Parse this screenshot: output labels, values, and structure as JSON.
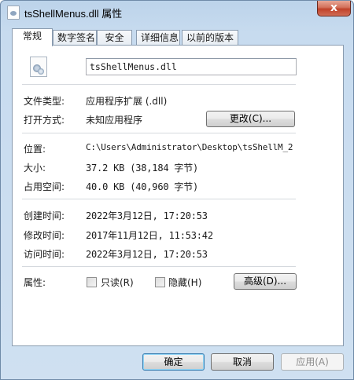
{
  "window": {
    "title": "tsShellMenus.dll 属性",
    "close_glyph": "x"
  },
  "tabs": [
    {
      "label": "常规",
      "active": true
    },
    {
      "label": "数字签名",
      "active": false
    },
    {
      "label": "安全",
      "active": false
    },
    {
      "label": "详细信息",
      "active": false
    },
    {
      "label": "以前的版本",
      "active": false
    }
  ],
  "file": {
    "name": "tsShellMenus.dll",
    "icon": "dll-file-icon"
  },
  "type_section": {
    "file_type_label": "文件类型:",
    "file_type_value": "应用程序扩展 (.dll)",
    "open_with_label": "打开方式:",
    "open_with_value": "未知应用程序",
    "change_button": "更改(C)..."
  },
  "location_section": {
    "location_label": "位置:",
    "location_value": "C:\\Users\\Administrator\\Desktop\\tsShellM_2",
    "size_label": "大小:",
    "size_value": "37.2 KB (38,184 字节)",
    "disk_size_label": "占用空间:",
    "disk_size_value": "40.0 KB (40,960 字节)"
  },
  "dates_section": {
    "created_label": "创建时间:",
    "created_value": "2022年3月12日, 17:20:53",
    "modified_label": "修改时间:",
    "modified_value": "2017年11月12日, 11:53:42",
    "accessed_label": "访问时间:",
    "accessed_value": "2022年3月12日, 17:20:53"
  },
  "attributes": {
    "label": "属性:",
    "readonly_label": "只读(R)",
    "readonly_checked": false,
    "hidden_label": "隐藏(H)",
    "hidden_checked": false,
    "advanced_button": "高级(D)..."
  },
  "footer": {
    "ok": "确定",
    "cancel": "取消",
    "apply": "应用(A)"
  }
}
